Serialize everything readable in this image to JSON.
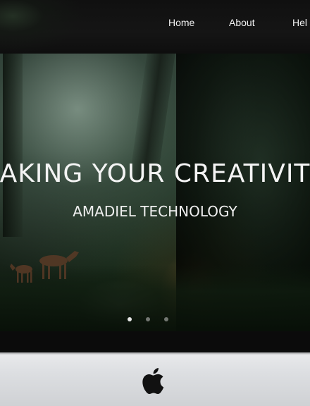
{
  "nav": {
    "items": [
      "Home",
      "About",
      "Hel"
    ]
  },
  "hero": {
    "title": "AKING YOUR CREATIVIT",
    "subtitle": "AMADIEL TECHNOLOGY",
    "carousel": {
      "dot_count": 3,
      "active_index": 0
    }
  },
  "device": {
    "logo_icon": "apple-logo-icon"
  },
  "colors": {
    "nav_bar": "#121212",
    "text": "#f4f4f4",
    "bezel": "#0b0b0b",
    "chin": "#dcdee1"
  }
}
